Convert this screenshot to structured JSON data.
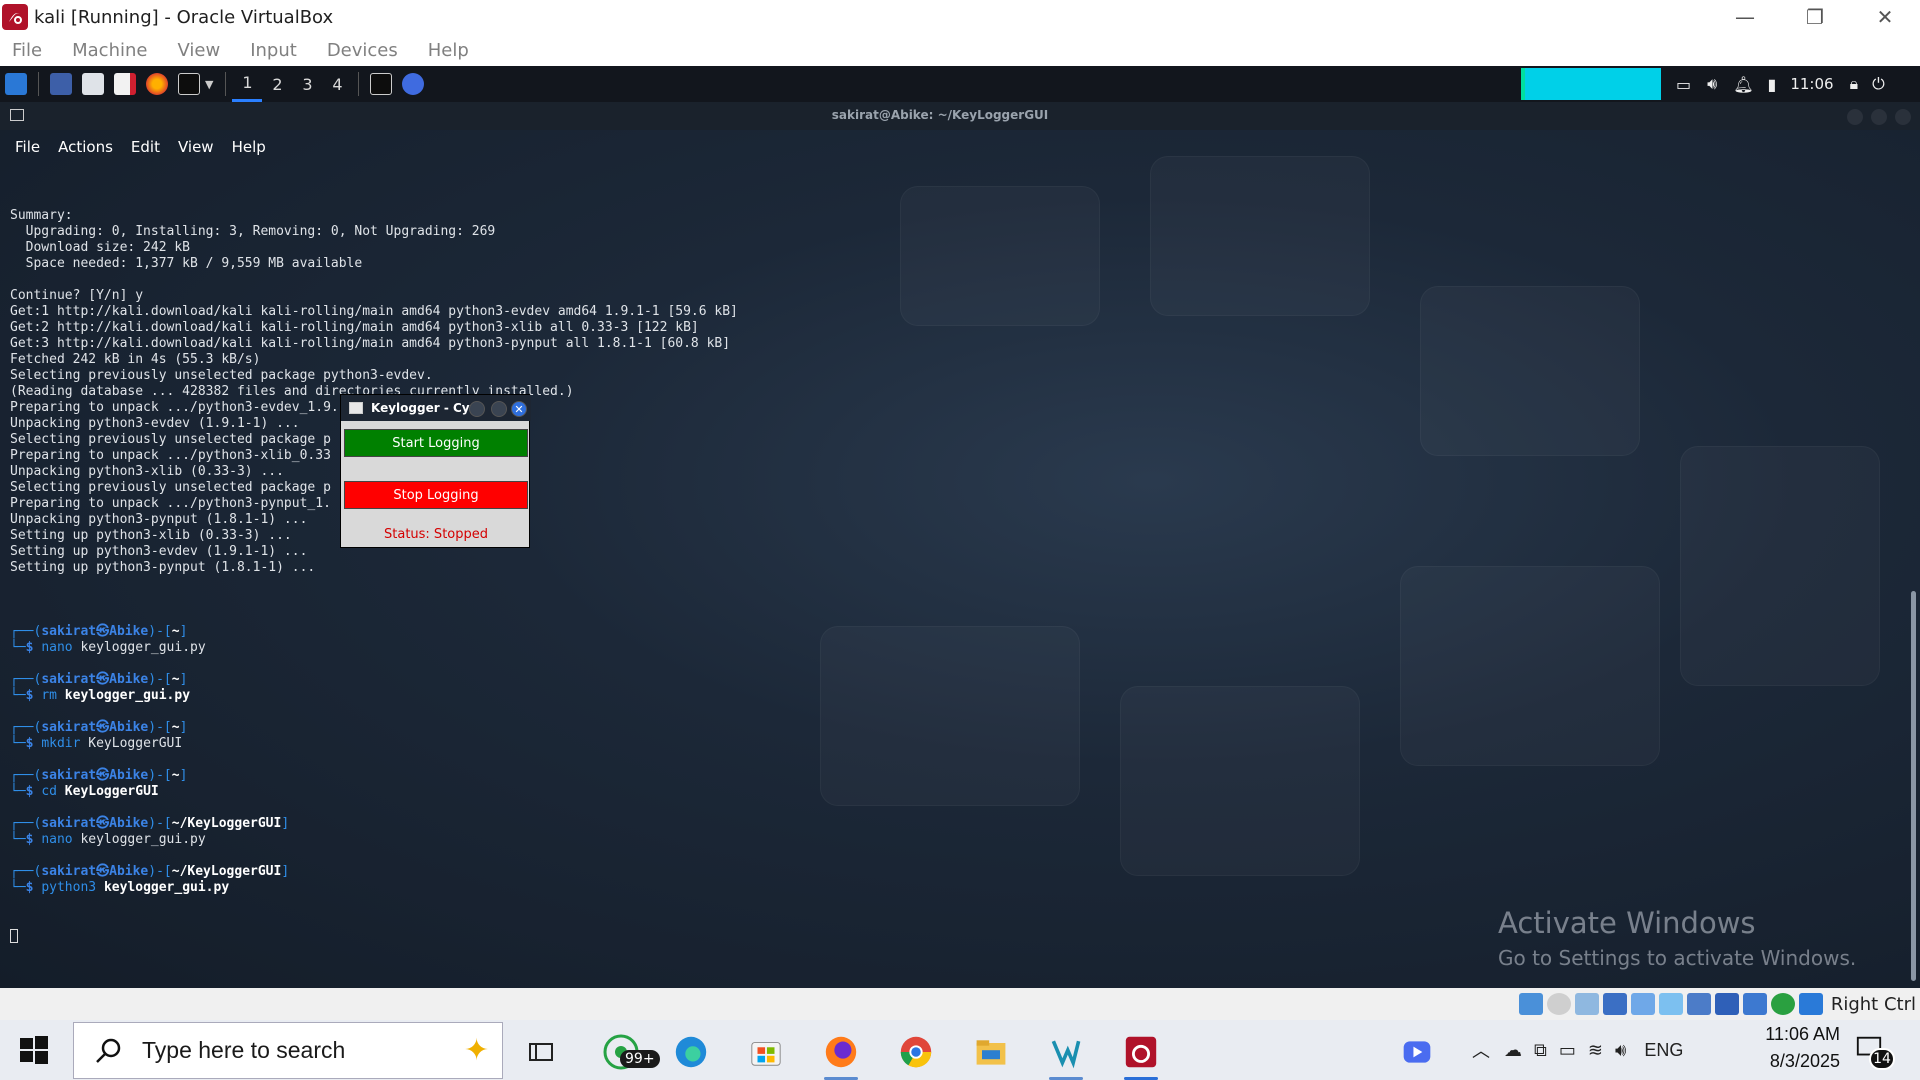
{
  "window": {
    "title": "kali [Running] - Oracle VirtualBox"
  },
  "vbox_menu": [
    "File",
    "Machine",
    "View",
    "Input",
    "Devices",
    "Help"
  ],
  "kali_panel": {
    "workspaces": [
      "1",
      "2",
      "3",
      "4"
    ],
    "clock": "11:06"
  },
  "terminal": {
    "title": "sakirat@Abike: ~/KeyLoggerGUI",
    "menu": [
      "File",
      "Actions",
      "Edit",
      "View",
      "Help"
    ],
    "output_lines": [
      "Summary:",
      "  Upgrading: 0, Installing: 3, Removing: 0, Not Upgrading: 269",
      "  Download size: 242 kB",
      "  Space needed: 1,377 kB / 9,559 MB available",
      "",
      "Continue? [Y/n] y",
      "Get:1 http://kali.download/kali kali-rolling/main amd64 python3-evdev amd64 1.9.1-1 [59.6 kB]",
      "Get:2 http://kali.download/kali kali-rolling/main amd64 python3-xlib all 0.33-3 [122 kB]",
      "Get:3 http://kali.download/kali kali-rolling/main amd64 python3-pynput all 1.8.1-1 [60.8 kB]",
      "Fetched 242 kB in 4s (55.3 kB/s)",
      "Selecting previously unselected package python3-evdev.",
      "(Reading database ... 428382 files and directories currently installed.)",
      "Preparing to unpack .../python3-evdev_1.9.1-1_amd64.deb ...",
      "Unpacking python3-evdev (1.9.1-1) ...",
      "Selecting previously unselected package p",
      "Preparing to unpack .../python3-xlib_0.33",
      "Unpacking python3-xlib (0.33-3) ...",
      "Selecting previously unselected package p",
      "Preparing to unpack .../python3-pynput_1.",
      "Unpacking python3-pynput (1.8.1-1) ...",
      "Setting up python3-xlib (0.33-3) ...",
      "Setting up python3-evdev (1.9.1-1) ...",
      "Setting up python3-pynput (1.8.1-1) ..."
    ],
    "prompts": [
      {
        "user": "sakirat",
        "host": "Abike",
        "dir": "~",
        "cmd": "nano",
        "arg": "keylogger_gui.py",
        "arg_bold": false
      },
      {
        "user": "sakirat",
        "host": "Abike",
        "dir": "~",
        "cmd": "rm",
        "arg": "keylogger_gui.py",
        "arg_bold": true
      },
      {
        "user": "sakirat",
        "host": "Abike",
        "dir": "~",
        "cmd": "mkdir",
        "arg": "KeyLoggerGUI",
        "arg_bold": false
      },
      {
        "user": "sakirat",
        "host": "Abike",
        "dir": "~",
        "cmd": "cd",
        "arg": "KeyLoggerGUI",
        "arg_bold": true
      },
      {
        "user": "sakirat",
        "host": "Abike",
        "dir": "~/KeyLoggerGUI",
        "cmd": "nano",
        "arg": "keylogger_gui.py",
        "arg_bold": false
      },
      {
        "user": "sakirat",
        "host": "Abike",
        "dir": "~/KeyLoggerGUI",
        "cmd": "python3",
        "arg": "keylogger_gui.py",
        "arg_bold": true
      }
    ]
  },
  "keylogger": {
    "title": "Keylogger - Cy",
    "start_label": "Start Logging",
    "stop_label": "Stop Logging",
    "status": "Status: Stopped"
  },
  "watermark": {
    "line1": "Activate Windows",
    "line2": "Go to Settings to activate Windows."
  },
  "vbox_status": {
    "host_key": "Right Ctrl"
  },
  "taskbar": {
    "search_placeholder": "Type here to search",
    "whatsapp_badge": "99+",
    "language": "ENG",
    "time": "11:06 AM",
    "date": "8/3/2025",
    "notifications": "14"
  },
  "colors": {
    "start_button": "#008000",
    "stop_button": "#ff0000",
    "status_text": "#d40000",
    "prompt_blue": "#3b83e6"
  }
}
